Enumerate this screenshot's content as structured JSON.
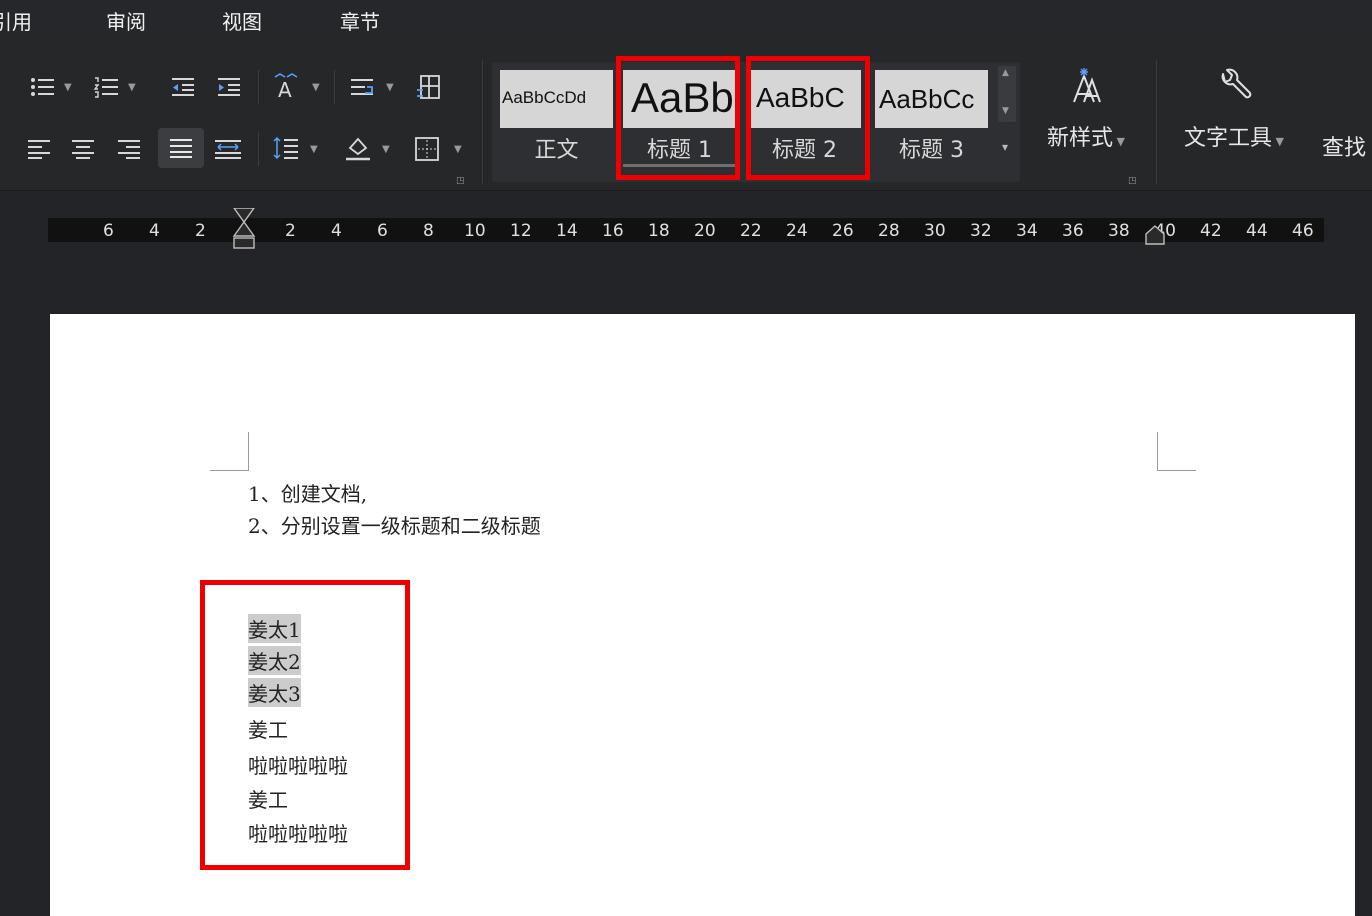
{
  "menu": {
    "items": [
      "引用",
      "审阅",
      "视图",
      "章节"
    ]
  },
  "styles": [
    {
      "preview": "AaBbCcDd",
      "label": "正文"
    },
    {
      "preview": "AaBb",
      "label": "标题 1"
    },
    {
      "preview": "AaBbC",
      "label": "标题 2"
    },
    {
      "preview": "AaBbCc",
      "label": "标题 3"
    }
  ],
  "tools": {
    "new_style": "新样式",
    "text_tools": "文字工具",
    "find": "查找"
  },
  "ruler": {
    "numbers": [
      "6",
      "4",
      "2",
      "2",
      "4",
      "6",
      "8",
      "10",
      "12",
      "14",
      "16",
      "18",
      "20",
      "22",
      "24",
      "26",
      "28",
      "30",
      "32",
      "34",
      "36",
      "38",
      "40",
      "42",
      "44",
      "46"
    ]
  },
  "document": {
    "lines": [
      "1、创建文档,",
      "2、分别设置一级标题和二级标题",
      "姜太1",
      "姜太2",
      "姜太3",
      "姜工",
      "啦啦啦啦啦",
      "姜工",
      "啦啦啦啦啦"
    ]
  },
  "colors": {
    "highlight_box": "#ee0000",
    "selection": "#cccccc",
    "toolbar_bg": "#262729"
  }
}
